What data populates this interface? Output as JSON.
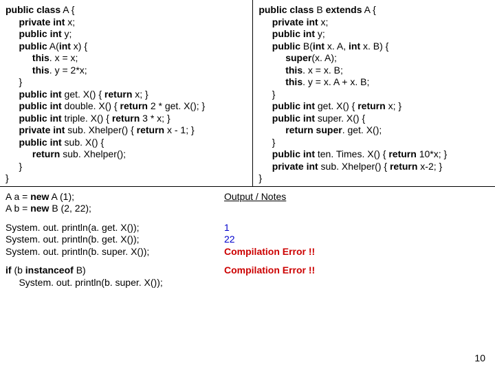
{
  "classA": {
    "l01a": "public class",
    "l01b": " A {",
    "l02a": "private int",
    "l02b": " x;",
    "l03a": "public int",
    "l03b": " y;",
    "l04a": "public",
    "l04b": " A(",
    "l04c": "int",
    "l04d": " x) {",
    "l05a": "this",
    "l05b": ". x = x;",
    "l06a": "this",
    "l06b": ". y = 2*x;",
    "l07": "}",
    "l08a": "public int",
    "l08b": " get. X() { ",
    "l08c": "return",
    "l08d": " x; }",
    "l09a": "public int",
    "l09b": " double. X() { ",
    "l09c": "return",
    "l09d": " 2 * get. X(); }",
    "l10a": "public int",
    "l10b": " triple. X() { ",
    "l10c": "return",
    "l10d": " 3 * x; }",
    "l11a": "private int",
    "l11b": " sub. Xhelper() { ",
    "l11c": "return",
    "l11d": " x - 1; }",
    "l12a": "public int",
    "l12b": " sub. X() {",
    "l13a": "return",
    "l13b": " sub. Xhelper();",
    "l14": "}",
    "l15": "}"
  },
  "classB": {
    "l01a": "public class",
    "l01b": " B ",
    "l01c": "extends",
    "l01d": " A {",
    "l02a": "private int",
    "l02b": " x;",
    "l03a": "public int",
    "l03b": " y;",
    "l04a": "public",
    "l04b": " B(",
    "l04c": "int",
    "l04d": " x. A, ",
    "l04e": "int",
    "l04f": " x. B) {",
    "l05a": "super",
    "l05b": "(x. A);",
    "l06a": "this",
    "l06b": ". x = x. B;",
    "l07a": "this",
    "l07b": ". y = x. A + x. B;",
    "l08": "}",
    "l09a": "public int",
    "l09b": " get. X() { ",
    "l09c": "return",
    "l09d": " x; }",
    "l10a": "public int",
    "l10b": " super. X() {",
    "l11a": "return super",
    "l11b": ". get. X();",
    "l12": "}",
    "l13a": "public int",
    "l13b": " ten. Times. X() { ",
    "l13c": "return",
    "l13d": " 10*x; }",
    "l14a": "private int",
    "l14b": " sub. Xhelper() { ",
    "l14c": "return",
    "l14d": " x-2; }",
    "l15": "}"
  },
  "decl": {
    "l1a": "A a = ",
    "l1b": "new",
    "l1c": " A (1);",
    "l2a": "A b = ",
    "l2b": "new",
    "l2c": " B (2, 22);"
  },
  "heading": "Output / Notes",
  "calls": {
    "c1": "System. out. println(a. get. X());",
    "c2": "System. out. println(b. get. X());",
    "c3": "System. out. println(b. super. X());",
    "c4a": "if",
    "c4b": " (b ",
    "c4c": "instanceof",
    "c4d": " B)",
    "c5": "System. out. println(b. super. X());"
  },
  "out": {
    "o1": "1",
    "o2": "22",
    "o3": "Compilation Error !!",
    "o4": "Compilation Error !!"
  },
  "pagenum": "10"
}
